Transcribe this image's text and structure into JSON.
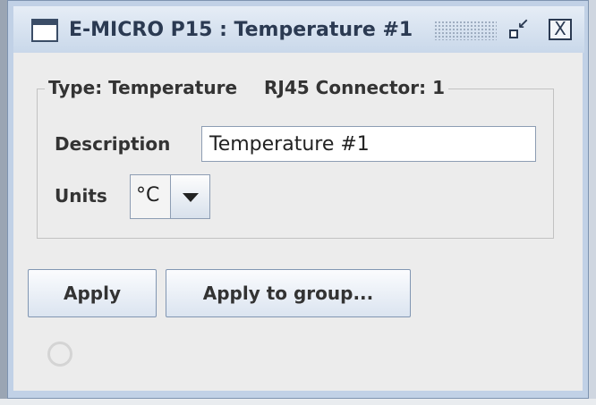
{
  "window": {
    "title": "E-MICRO P15 : Temperature #1",
    "icons": [
      "window-icon",
      "restore-icon",
      "close-icon"
    ],
    "close_glyph": "X"
  },
  "group": {
    "type_label": "Type:",
    "type_value": "Temperature",
    "connector_label": "RJ45 Connector:",
    "connector_value": "1"
  },
  "form": {
    "description_label": "Description",
    "description_value": "Temperature #1",
    "units_label": "Units",
    "units_value": "°C"
  },
  "buttons": {
    "apply": "Apply",
    "apply_group": "Apply to group..."
  },
  "colors": {
    "frame": "#c1d1e6",
    "content": "#ececec",
    "text": "#333333"
  }
}
